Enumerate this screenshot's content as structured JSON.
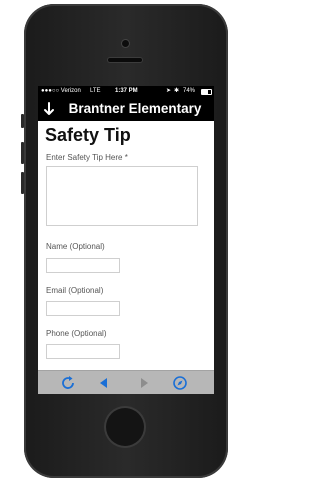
{
  "status_bar": {
    "carrier": "●●●○○ Verizon",
    "network": "LTE",
    "time": "1:37 PM",
    "battery": "74%"
  },
  "nav_bar": {
    "title": "Brantner Elementary",
    "back_icon": "down-arrow-icon"
  },
  "form": {
    "page_title": "Safety Tip",
    "tip_label": "Enter Safety Tip Here *",
    "tip_value": "",
    "name_label": "Name (Optional)",
    "name_value": "",
    "email_label": "Email (Optional)",
    "email_value": "",
    "phone_label": "Phone (Optional)",
    "phone_value": ""
  },
  "toolbar": {
    "buttons": [
      "reload-icon",
      "back-icon",
      "forward-icon",
      "compass-icon"
    ],
    "active_color": "#1a6fd6",
    "disabled_color": "#8d8d8d"
  },
  "colors": {
    "nav_background": "#000000",
    "toolbar_background": "#b7b7b7"
  }
}
